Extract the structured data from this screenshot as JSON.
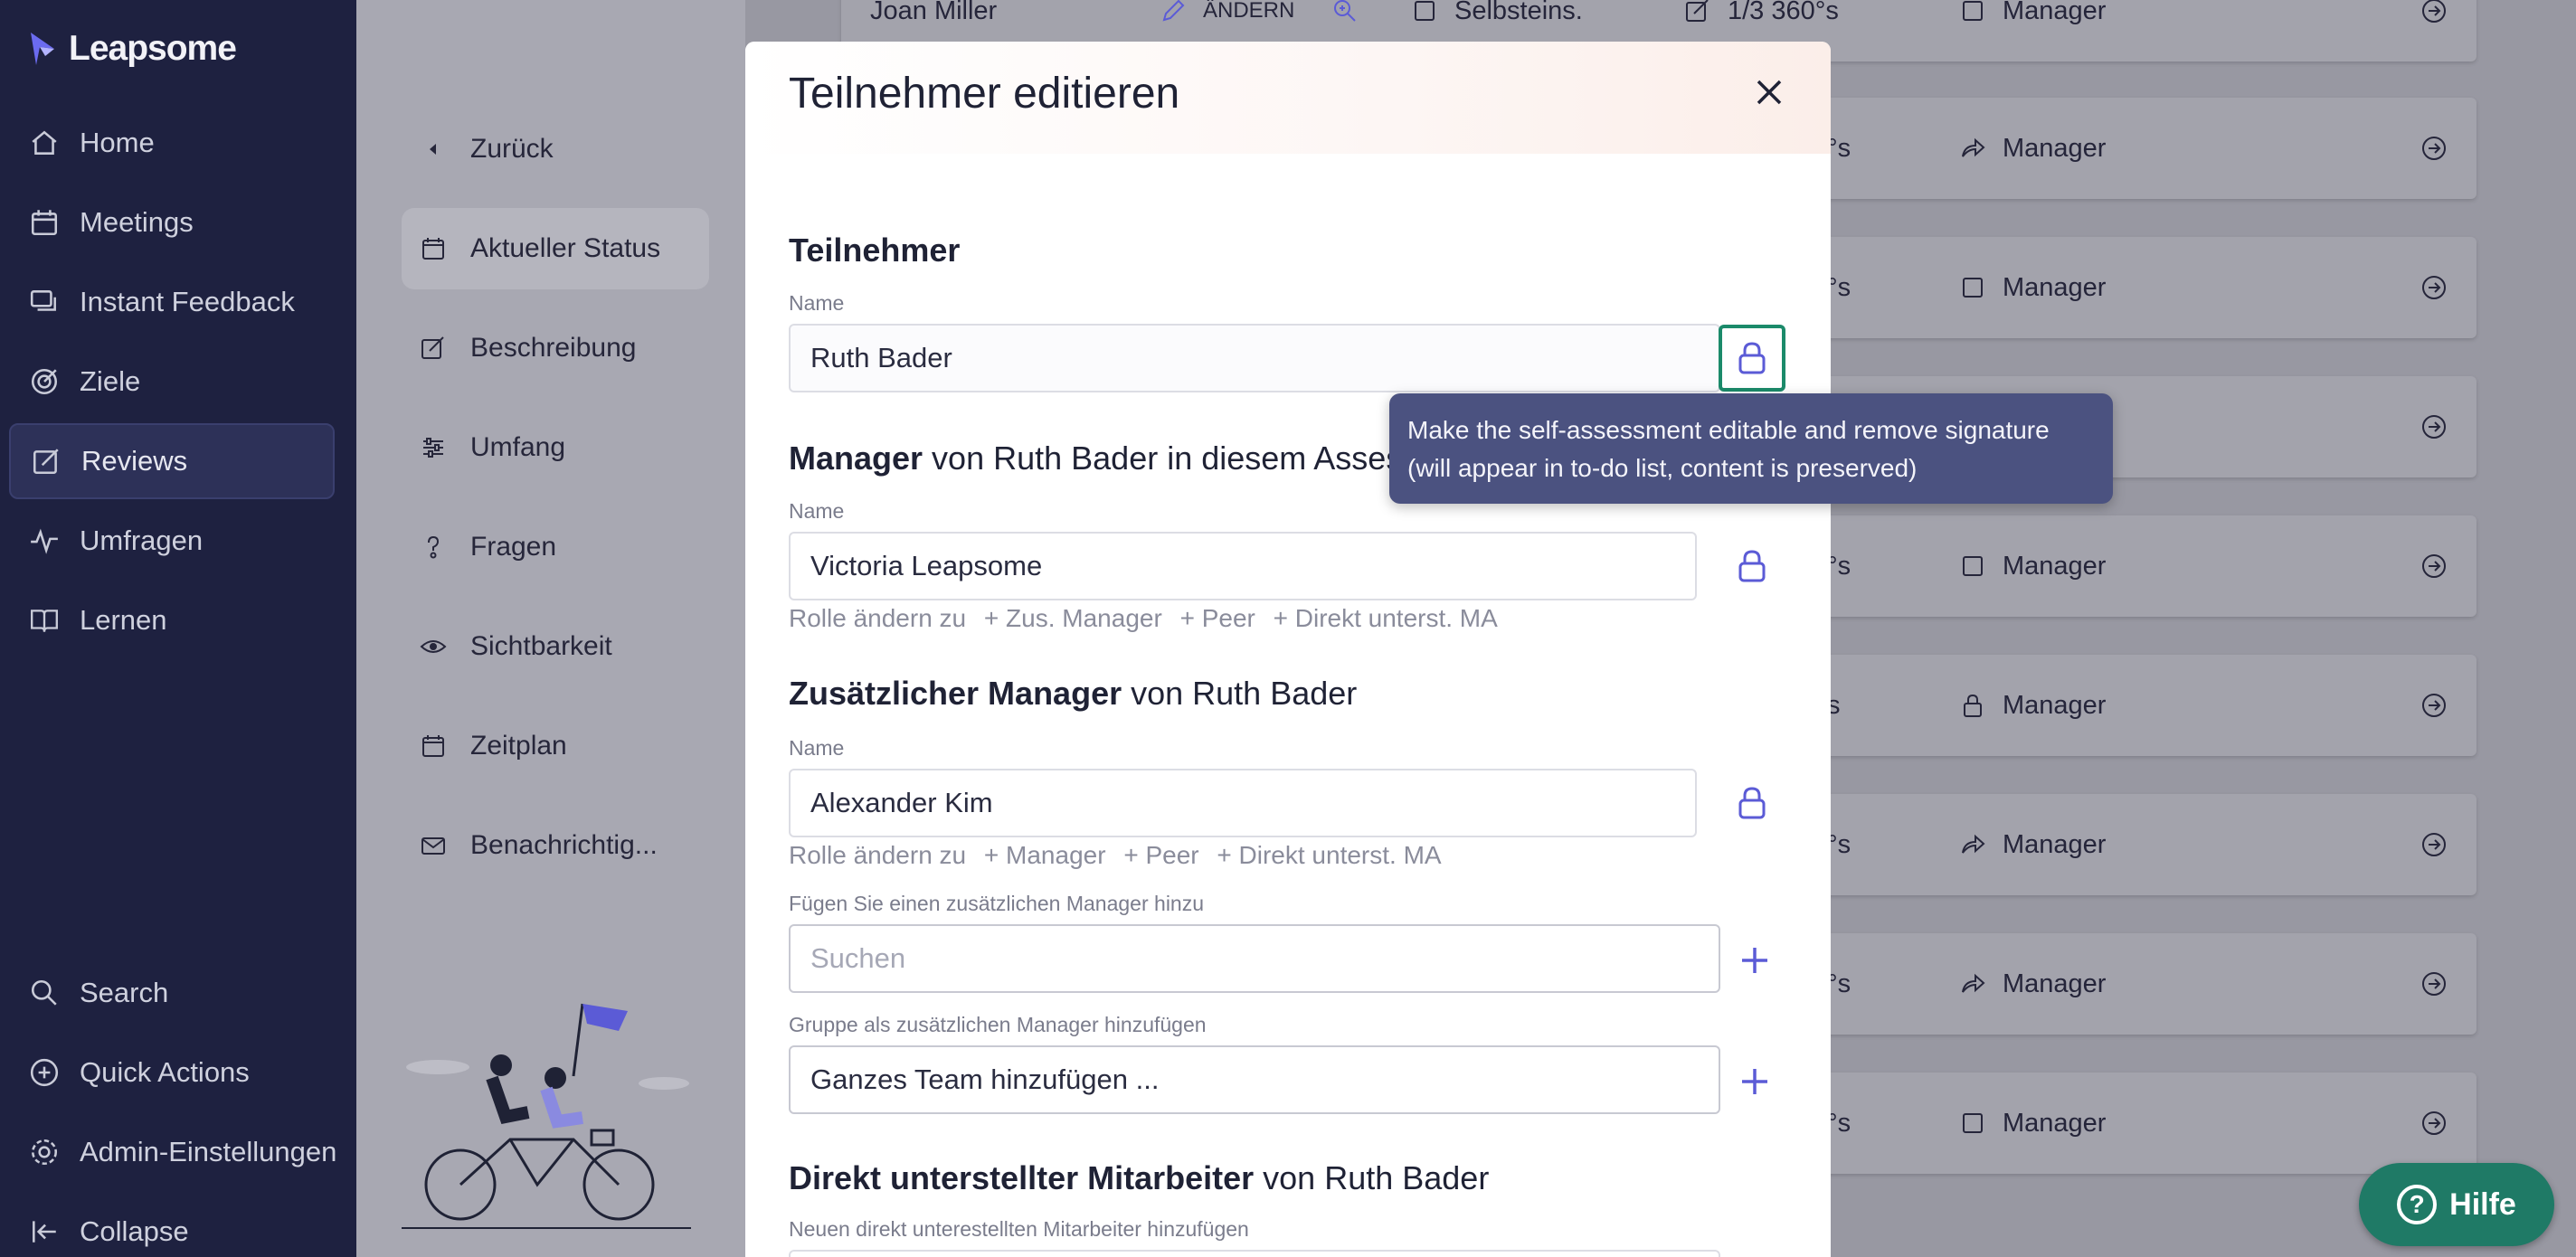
{
  "app": {
    "logo_text": "Leapsome"
  },
  "sidebar": {
    "items": [
      {
        "label": "Home",
        "icon": "home-icon"
      },
      {
        "label": "Meetings",
        "icon": "calendar-icon"
      },
      {
        "label": "Instant Feedback",
        "icon": "chat-icon"
      },
      {
        "label": "Ziele",
        "icon": "target-icon"
      },
      {
        "label": "Reviews",
        "icon": "edit-icon",
        "active": true
      },
      {
        "label": "Umfragen",
        "icon": "pulse-icon"
      },
      {
        "label": "Lernen",
        "icon": "book-icon"
      }
    ],
    "bottom_items": [
      {
        "label": "Search",
        "icon": "search-icon"
      },
      {
        "label": "Quick Actions",
        "icon": "plus-circle-icon"
      },
      {
        "label": "Admin-Einstellungen",
        "icon": "gear-icon"
      },
      {
        "label": "Collapse",
        "icon": "collapse-icon"
      }
    ]
  },
  "sub_sidebar": {
    "items": [
      {
        "label": "Zurück",
        "icon": "chevron-left-icon"
      },
      {
        "label": "Aktueller Status",
        "icon": "calendar-icon",
        "active": true
      },
      {
        "label": "Beschreibung",
        "icon": "edit-icon"
      },
      {
        "label": "Umfang",
        "icon": "sliders-icon"
      },
      {
        "label": "Fragen",
        "icon": "question-icon"
      },
      {
        "label": "Sichtbarkeit",
        "icon": "eye-icon"
      },
      {
        "label": "Zeitplan",
        "icon": "calendar-icon"
      },
      {
        "label": "Benachrichtig...",
        "icon": "mail-icon"
      }
    ]
  },
  "background_rows": {
    "first_row": {
      "name": "Joan Miller",
      "change_label": "ÄNDERN",
      "self_label": "Selbsteins.",
      "feedback_label": "1/3 360°s",
      "role_label": "Manager"
    },
    "rows": [
      {
        "status_suffix": "°s",
        "role_icon": "share-icon",
        "role": "Manager"
      },
      {
        "status_suffix": "°s",
        "role_icon": "checkbox-icon",
        "role": "Manager"
      },
      {
        "status_suffix": "",
        "role_icon": "",
        "role": ""
      },
      {
        "status_suffix": "°s",
        "role_icon": "checkbox-icon",
        "role": "Manager"
      },
      {
        "status_suffix": "s",
        "role_icon": "lock-icon",
        "role": "Manager"
      },
      {
        "status_suffix": "°s",
        "role_icon": "share-icon",
        "role": "Manager"
      },
      {
        "status_suffix": "°s",
        "role_icon": "share-icon",
        "role": "Manager"
      },
      {
        "status_suffix": "°s",
        "role_icon": "checkbox-icon",
        "role": "Manager"
      }
    ]
  },
  "modal": {
    "title": "Teilnehmer editieren",
    "participant": {
      "heading": "Teilnehmer",
      "field_label": "Name",
      "value": "Ruth Bader"
    },
    "manager": {
      "heading_bold": "Manager",
      "heading_rest": " von Ruth Bader in diesem Assess",
      "field_label": "Name",
      "value": "Victoria Leapsome",
      "role_prefix": "Rolle ändern zu",
      "role_options": [
        "+ Zus. Manager",
        "+ Peer",
        "+ Direkt unterst. MA"
      ]
    },
    "additional_manager": {
      "heading_bold": "Zusätzlicher Manager",
      "heading_rest": " von Ruth Bader",
      "field_label": "Name",
      "value": "Alexander Kim",
      "role_prefix": "Rolle ändern zu",
      "role_options": [
        "+ Manager",
        "+ Peer",
        "+ Direkt unterst. MA"
      ],
      "add_label": "Fügen Sie einen zusätzlichen Manager hinzu",
      "search_placeholder": "Suchen",
      "group_label": "Gruppe als zusätzlichen Manager hinzufügen",
      "group_value": "Ganzes Team hinzufügen ..."
    },
    "direct_report": {
      "heading_bold": "Direkt unterstellter Mitarbeiter",
      "heading_rest": " von Ruth Bader",
      "add_label": "Neuen direkt unterestellten Mitarbeiter hinzufügen"
    }
  },
  "tooltip": {
    "text": "Make the self-assessment editable and remove signature (will appear in to-do list, content is preserved)"
  },
  "help": {
    "label": "Hilfe"
  },
  "colors": {
    "sidebar_bg": "#1e2140",
    "tooltip_bg": "#4b5280",
    "accent": "#5b5bd6",
    "focus_green": "#1b8a6a",
    "help_green": "#1f7a66"
  }
}
